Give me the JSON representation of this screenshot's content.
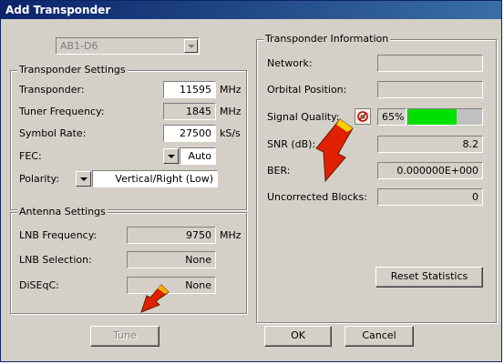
{
  "window": {
    "title": "Add Transponder"
  },
  "satellite": {
    "selected": "AB1-D6"
  },
  "transponder_settings": {
    "group_title": "Transponder Settings",
    "transponder": {
      "label": "Transponder:",
      "value": "11595",
      "unit": "MHz"
    },
    "tuner_frequency": {
      "label": "Tuner Frequency:",
      "value": "1845",
      "unit": "MHz"
    },
    "symbol_rate": {
      "label": "Symbol Rate:",
      "value": "27500",
      "unit": "kS/s"
    },
    "fec": {
      "label": "FEC:",
      "value": "Auto"
    },
    "polarity": {
      "label": "Polarity:",
      "value": "Vertical/Right (Low)"
    }
  },
  "antenna_settings": {
    "group_title": "Antenna Settings",
    "lnb_frequency": {
      "label": "LNB Frequency:",
      "value": "9750",
      "unit": "MHz"
    },
    "lnb_selection": {
      "label": "LNB Selection:",
      "value": "None"
    },
    "diseqc": {
      "label": "DiSEqC:",
      "value": "None"
    }
  },
  "transponder_information": {
    "group_title": "Transponder Information",
    "network": {
      "label": "Network:",
      "value": ""
    },
    "orbital_position": {
      "label": "Orbital Position:",
      "value": ""
    },
    "signal_quality": {
      "label": "Signal Quality:",
      "percent_text": "65%",
      "level": 0.65,
      "fill_color": "#00e000"
    },
    "snr": {
      "label": "SNR (dB):",
      "value": "8.2"
    },
    "ber": {
      "label": "BER:",
      "value": "0.000000E+000"
    },
    "uncorrected_blocks": {
      "label": "Uncorrected Blocks:",
      "value": "0"
    },
    "reset_label": "Reset Statistics"
  },
  "buttons": {
    "tune": "Tune",
    "ok": "OK",
    "cancel": "Cancel"
  }
}
